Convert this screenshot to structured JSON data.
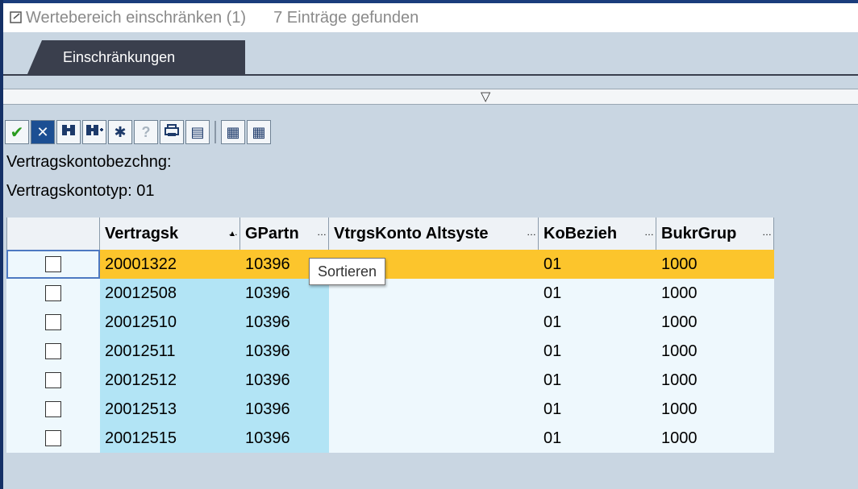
{
  "title": {
    "text": "Wertebereich einschränken (1)",
    "count": "7 Einträge gefunden"
  },
  "tabs": [
    {
      "label": "Einschränkungen"
    }
  ],
  "toolbar": {
    "buttons": [
      {
        "name": "accept",
        "icon": "check-icon",
        "glyph": "✔"
      },
      {
        "name": "cancel",
        "icon": "cancel-icon",
        "glyph": "✕"
      },
      {
        "name": "find",
        "icon": "binoculars-icon",
        "glyph": "⛶"
      },
      {
        "name": "find-next",
        "icon": "binoculars-plus-icon",
        "glyph": "⛶"
      },
      {
        "name": "new-search",
        "icon": "new-entries-icon",
        "glyph": "✱"
      },
      {
        "name": "help",
        "icon": "info-icon",
        "glyph": "?"
      },
      {
        "name": "print",
        "icon": "print-icon",
        "glyph": "⎙"
      },
      {
        "name": "print-preview",
        "icon": "list-icon",
        "glyph": "▤"
      },
      {
        "name": "export",
        "icon": "export-icon",
        "glyph": "▦"
      },
      {
        "name": "export-2",
        "icon": "document-icon",
        "glyph": "▦"
      }
    ]
  },
  "info": {
    "line1": "Vertragskontobezchng:",
    "line2": "Vertragskontotyp: 01"
  },
  "table": {
    "columns": [
      {
        "label": "Vertragsk",
        "truncated": true
      },
      {
        "label": "GPartn",
        "truncated": true
      },
      {
        "label": "VtrgsKonto Altsyste",
        "truncated": true
      },
      {
        "label": "KoBezieh",
        "truncated": true
      },
      {
        "label": "BukrGrup",
        "truncated": true
      }
    ],
    "rows": [
      {
        "vertragsk": "20001322",
        "gpartn": "10396",
        "altsystem": "",
        "kobezieh": "01",
        "bukrgrup": "1000",
        "selected": true
      },
      {
        "vertragsk": "20012508",
        "gpartn": "10396",
        "altsystem": "",
        "kobezieh": "01",
        "bukrgrup": "1000",
        "selected": false
      },
      {
        "vertragsk": "20012510",
        "gpartn": "10396",
        "altsystem": "",
        "kobezieh": "01",
        "bukrgrup": "1000",
        "selected": false
      },
      {
        "vertragsk": "20012511",
        "gpartn": "10396",
        "altsystem": "",
        "kobezieh": "01",
        "bukrgrup": "1000",
        "selected": false
      },
      {
        "vertragsk": "20012512",
        "gpartn": "10396",
        "altsystem": "",
        "kobezieh": "01",
        "bukrgrup": "1000",
        "selected": false
      },
      {
        "vertragsk": "20012513",
        "gpartn": "10396",
        "altsystem": "",
        "kobezieh": "01",
        "bukrgrup": "1000",
        "selected": false
      },
      {
        "vertragsk": "20012515",
        "gpartn": "10396",
        "altsystem": "",
        "kobezieh": "01",
        "bukrgrup": "1000",
        "selected": false
      }
    ]
  },
  "tooltip": "Sortieren",
  "colors": {
    "selected_row": "#fcc52c",
    "key_column": "#b2e4f5",
    "row_background": "#eef8fd",
    "tab_background": "#3a3f4d",
    "background": "#c9d6e2"
  }
}
